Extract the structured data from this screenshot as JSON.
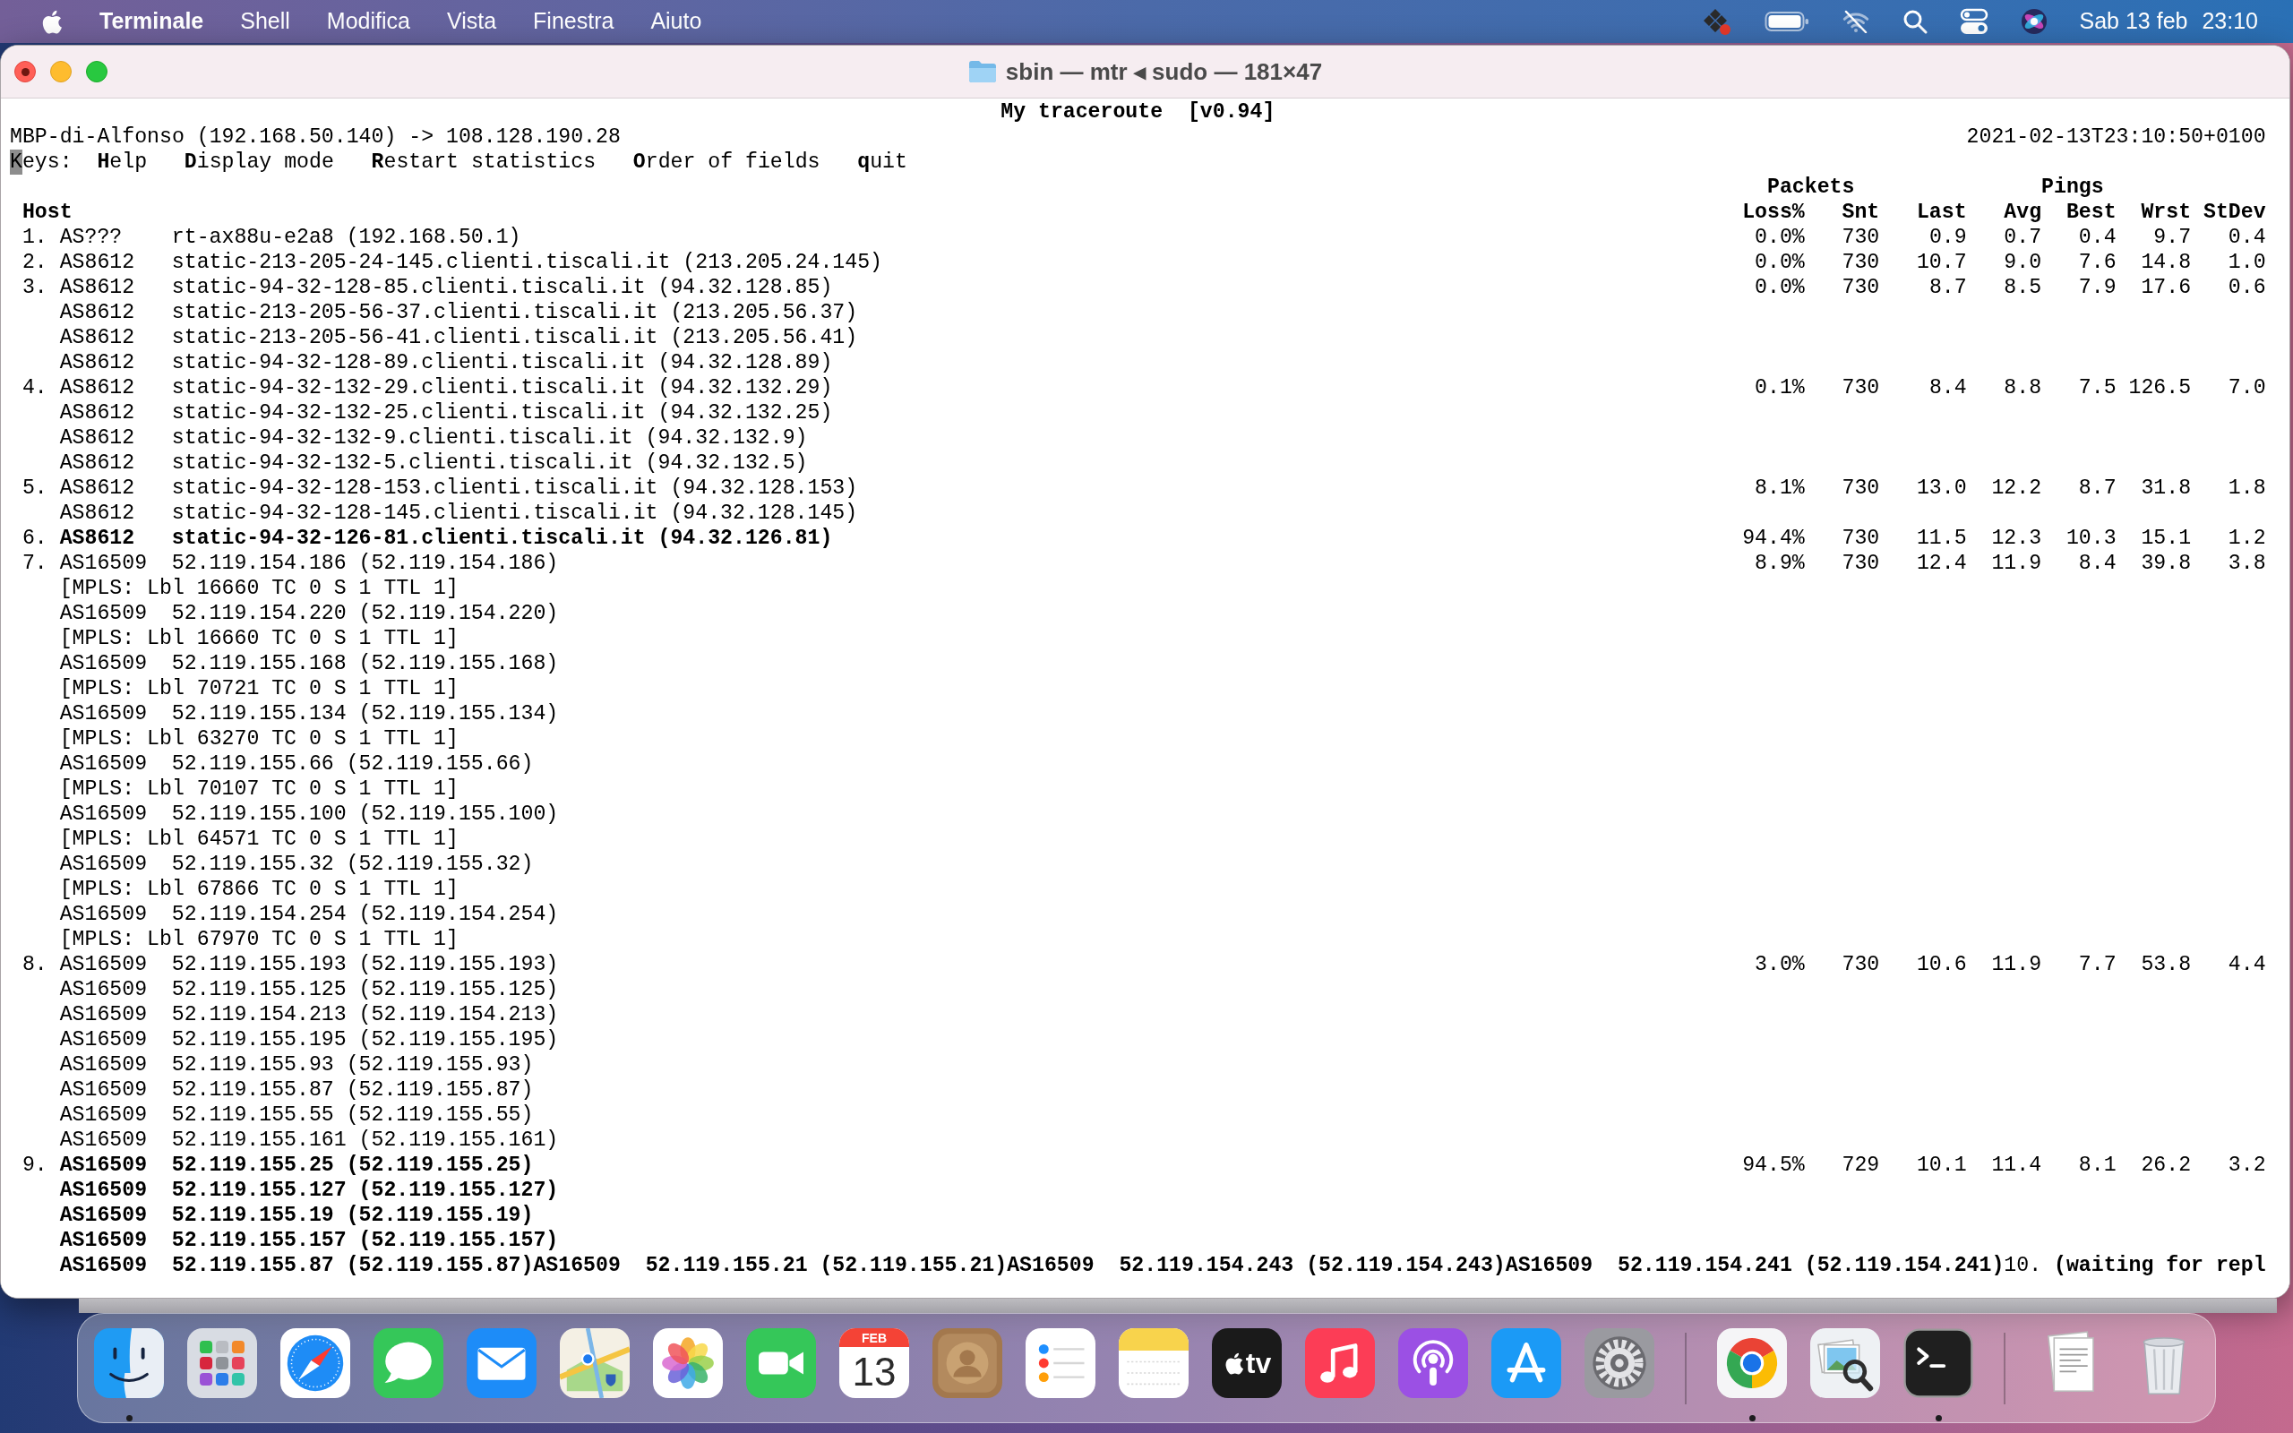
{
  "menu_bar": {
    "app_name": "Terminale",
    "menus": [
      "Shell",
      "Modifica",
      "Vista",
      "Finestra",
      "Aiuto"
    ],
    "wifi_connected": false,
    "date": "Sab 13 feb",
    "time": "23:10"
  },
  "window": {
    "title": "sbin — mtr ◂ sudo — 181×47",
    "process_running": true
  },
  "terminal": {
    "title": "My traceroute  [v0.94]",
    "route": "MBP-di-Alfonso (192.168.50.140) -> 108.128.190.28",
    "timestamp": "2021-02-13T23:10:50+0100",
    "keys_line": {
      "cursor": "K",
      "text": "eys:  **H**elp   **D**isplay mode   **R**estart statistics   **O**rder of fields   **q**uit"
    },
    "host_heading": "Host",
    "column_groups": [
      {
        "label": "Packets",
        "columns": [
          {
            "label": "Loss%"
          },
          {
            "label": "Snt"
          }
        ]
      },
      {
        "label": "Pings",
        "columns": [
          {
            "label": "Last"
          },
          {
            "label": "Avg"
          },
          {
            "label": "Best"
          },
          {
            "label": "Wrst"
          },
          {
            "label": "StDev"
          }
        ]
      }
    ],
    "hops": [
      {
        "number": "1.",
        "highlighted": false,
        "stats": [
          "0.0%",
          "730",
          "0.9",
          "0.7",
          "0.4",
          "9.7",
          "0.4"
        ],
        "hosts": [
          {
            "asn": "AS???",
            "host": "rt-ax88u-e2a8 (192.168.50.1)"
          }
        ]
      },
      {
        "number": "2.",
        "highlighted": false,
        "stats": [
          "0.0%",
          "730",
          "10.7",
          "9.0",
          "7.6",
          "14.8",
          "1.0"
        ],
        "hosts": [
          {
            "asn": "AS8612",
            "host": "static-213-205-24-145.clienti.tiscali.it (213.205.24.145)"
          }
        ]
      },
      {
        "number": "3.",
        "highlighted": false,
        "stats": [
          "0.0%",
          "730",
          "8.7",
          "8.5",
          "7.9",
          "17.6",
          "0.6"
        ],
        "hosts": [
          {
            "asn": "AS8612",
            "host": "static-94-32-128-85.clienti.tiscali.it (94.32.128.85)"
          },
          {
            "asn": "AS8612",
            "host": "static-213-205-56-37.clienti.tiscali.it (213.205.56.37)"
          },
          {
            "asn": "AS8612",
            "host": "static-213-205-56-41.clienti.tiscali.it (213.205.56.41)"
          },
          {
            "asn": "AS8612",
            "host": "static-94-32-128-89.clienti.tiscali.it (94.32.128.89)"
          }
        ]
      },
      {
        "number": "4.",
        "highlighted": false,
        "stats": [
          "0.1%",
          "730",
          "8.4",
          "8.8",
          "7.5",
          "126.5",
          "7.0"
        ],
        "hosts": [
          {
            "asn": "AS8612",
            "host": "static-94-32-132-29.clienti.tiscali.it (94.32.132.29)"
          },
          {
            "asn": "AS8612",
            "host": "static-94-32-132-25.clienti.tiscali.it (94.32.132.25)"
          },
          {
            "asn": "AS8612",
            "host": "static-94-32-132-9.clienti.tiscali.it (94.32.132.9)"
          },
          {
            "asn": "AS8612",
            "host": "static-94-32-132-5.clienti.tiscali.it (94.32.132.5)"
          }
        ]
      },
      {
        "number": "5.",
        "highlighted": false,
        "stats": [
          "8.1%",
          "730",
          "13.0",
          "12.2",
          "8.7",
          "31.8",
          "1.8"
        ],
        "hosts": [
          {
            "asn": "AS8612",
            "host": "static-94-32-128-153.clienti.tiscali.it (94.32.128.153)"
          },
          {
            "asn": "AS8612",
            "host": "static-94-32-128-145.clienti.tiscali.it (94.32.128.145)"
          }
        ]
      },
      {
        "number": "6.",
        "highlighted": true,
        "stats": [
          "94.4%",
          "730",
          "11.5",
          "12.3",
          "10.3",
          "15.1",
          "1.2"
        ],
        "hosts": [
          {
            "asn": "AS8612",
            "host": "static-94-32-126-81.clienti.tiscali.it (94.32.126.81)"
          }
        ]
      },
      {
        "number": "7.",
        "highlighted": false,
        "stats": [
          "8.9%",
          "730",
          "12.4",
          "11.9",
          "8.4",
          "39.8",
          "3.8"
        ],
        "hosts": [
          {
            "asn": "AS16509",
            "host": "52.119.154.186 (52.119.154.186)",
            "mpls": "[MPLS: Lbl 16660 TC 0 S 1 TTL 1]"
          },
          {
            "asn": "AS16509",
            "host": "52.119.154.220 (52.119.154.220)",
            "mpls": "[MPLS: Lbl 16660 TC 0 S 1 TTL 1]"
          },
          {
            "asn": "AS16509",
            "host": "52.119.155.168 (52.119.155.168)",
            "mpls": "[MPLS: Lbl 70721 TC 0 S 1 TTL 1]"
          },
          {
            "asn": "AS16509",
            "host": "52.119.155.134 (52.119.155.134)",
            "mpls": "[MPLS: Lbl 63270 TC 0 S 1 TTL 1]"
          },
          {
            "asn": "AS16509",
            "host": "52.119.155.66 (52.119.155.66)",
            "mpls": "[MPLS: Lbl 70107 TC 0 S 1 TTL 1]"
          },
          {
            "asn": "AS16509",
            "host": "52.119.155.100 (52.119.155.100)",
            "mpls": "[MPLS: Lbl 64571 TC 0 S 1 TTL 1]"
          },
          {
            "asn": "AS16509",
            "host": "52.119.155.32 (52.119.155.32)",
            "mpls": "[MPLS: Lbl 67866 TC 0 S 1 TTL 1]"
          },
          {
            "asn": "AS16509",
            "host": "52.119.154.254 (52.119.154.254)",
            "mpls": "[MPLS: Lbl 67970 TC 0 S 1 TTL 1]"
          }
        ]
      },
      {
        "number": "8.",
        "highlighted": false,
        "stats": [
          "3.0%",
          "730",
          "10.6",
          "11.9",
          "7.7",
          "53.8",
          "4.4"
        ],
        "hosts": [
          {
            "asn": "AS16509",
            "host": "52.119.155.193 (52.119.155.193)"
          },
          {
            "asn": "AS16509",
            "host": "52.119.155.125 (52.119.155.125)"
          },
          {
            "asn": "AS16509",
            "host": "52.119.154.213 (52.119.154.213)"
          },
          {
            "asn": "AS16509",
            "host": "52.119.155.195 (52.119.155.195)"
          },
          {
            "asn": "AS16509",
            "host": "52.119.155.93 (52.119.155.93)"
          },
          {
            "asn": "AS16509",
            "host": "52.119.155.87 (52.119.155.87)"
          },
          {
            "asn": "AS16509",
            "host": "52.119.155.55 (52.119.155.55)"
          },
          {
            "asn": "AS16509",
            "host": "52.119.155.161 (52.119.155.161)"
          }
        ]
      },
      {
        "number": "9.",
        "highlighted": true,
        "stats": [
          "94.5%",
          "729",
          "10.1",
          "11.4",
          "8.1",
          "26.2",
          "3.2"
        ],
        "hosts": [
          {
            "asn": "AS16509",
            "host": "52.119.155.25 (52.119.155.25)"
          },
          {
            "asn": "AS16509",
            "host": "52.119.155.127 (52.119.155.127)"
          },
          {
            "asn": "AS16509",
            "host": "52.119.155.19 (52.119.155.19)"
          },
          {
            "asn": "AS16509",
            "host": "52.119.155.157 (52.119.155.157)"
          }
        ]
      }
    ],
    "overflow_line": "**AS16509  52.119.155.87 (52.119.155.87)AS16509  52.119.155.21 (52.119.155.21)AS16509  52.119.154.243 (52.119.154.243)AS16509  52.119.154.241 (52.119.154.241)**10. **(waiting for repl**"
  },
  "dock": {
    "items": [
      {
        "kind": "finder",
        "running": true
      },
      {
        "kind": "launchpad",
        "running": false
      },
      {
        "kind": "safari",
        "running": false
      },
      {
        "kind": "messages",
        "running": false
      },
      {
        "kind": "mail",
        "running": false
      },
      {
        "kind": "maps",
        "running": false
      },
      {
        "kind": "photos",
        "running": false
      },
      {
        "kind": "facetime",
        "running": false
      },
      {
        "kind": "calendar",
        "running": false,
        "month": "FEB",
        "day": "13"
      },
      {
        "kind": "contacts",
        "running": false
      },
      {
        "kind": "reminders",
        "running": false
      },
      {
        "kind": "notes",
        "running": false
      },
      {
        "kind": "tv",
        "running": false,
        "text": "tv"
      },
      {
        "kind": "music",
        "running": false
      },
      {
        "kind": "podcasts",
        "running": false
      },
      {
        "kind": "app_store",
        "running": false
      },
      {
        "kind": "settings",
        "running": false
      },
      {
        "kind": "separator"
      },
      {
        "kind": "chrome",
        "running": true
      },
      {
        "kind": "preview",
        "running": false
      },
      {
        "kind": "terminal",
        "running": true
      },
      {
        "kind": "separator"
      },
      {
        "kind": "documents",
        "running": false
      },
      {
        "kind": "trash",
        "running": false
      }
    ]
  }
}
